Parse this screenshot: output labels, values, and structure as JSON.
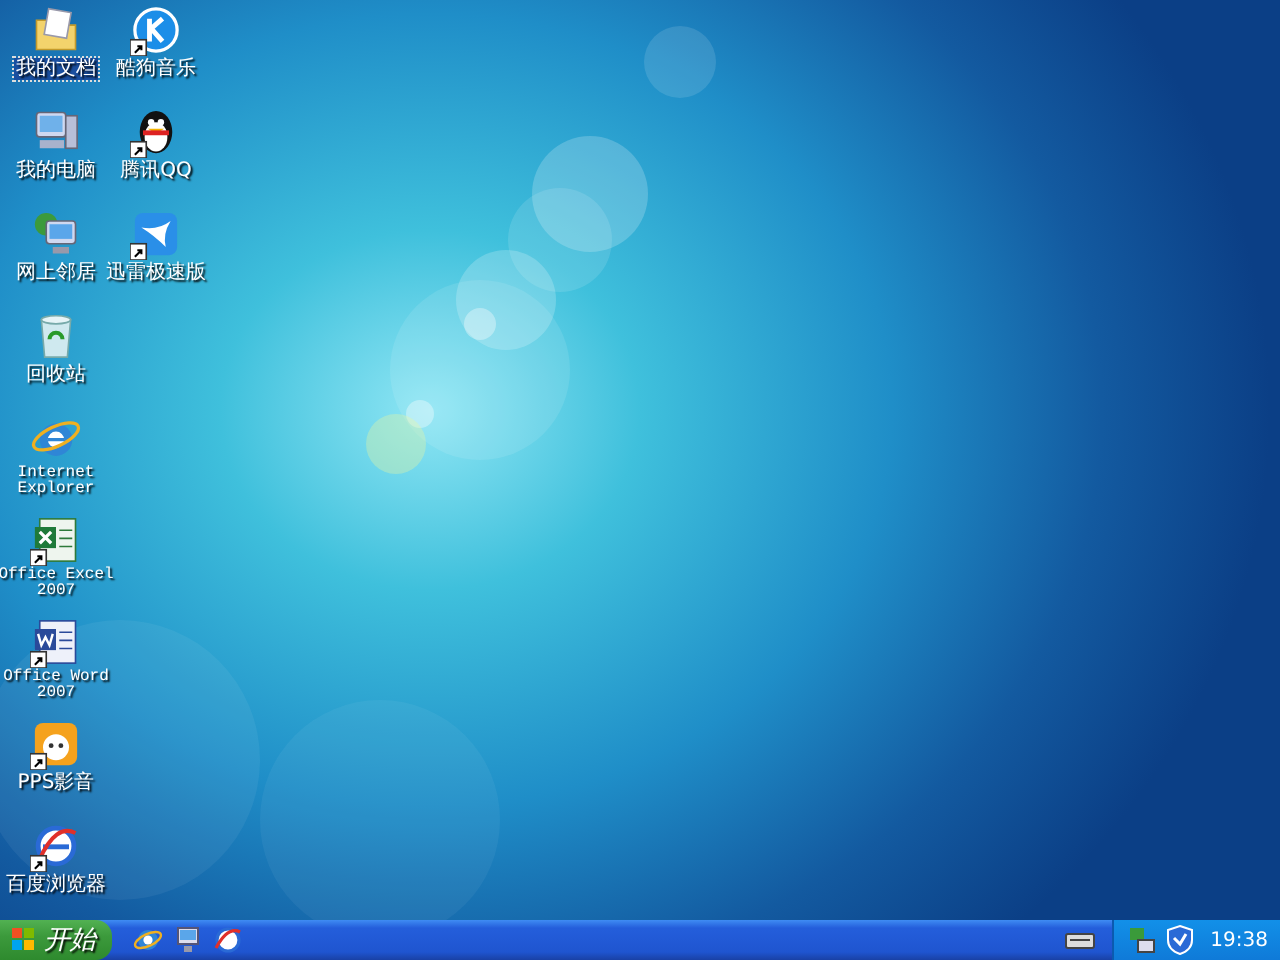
{
  "desktop": {
    "columns": [
      {
        "icons": [
          {
            "kind": "documents",
            "label": "我的文档",
            "shortcut": false,
            "selected": true
          },
          {
            "kind": "computer",
            "label": "我的电脑",
            "shortcut": false,
            "selected": false
          },
          {
            "kind": "network",
            "label": "网上邻居",
            "shortcut": false,
            "selected": false
          },
          {
            "kind": "recycle",
            "label": "回收站",
            "shortcut": false,
            "selected": false
          },
          {
            "kind": "ie",
            "label": "Internet Explorer",
            "shortcut": false,
            "selected": false
          },
          {
            "kind": "excel",
            "label": "Office Excel 2007",
            "shortcut": true,
            "selected": false
          },
          {
            "kind": "word",
            "label": "Office Word 2007",
            "shortcut": true,
            "selected": false
          },
          {
            "kind": "pps",
            "label": "PPS影音",
            "shortcut": true,
            "selected": false
          },
          {
            "kind": "browser",
            "label": "百度浏览器",
            "shortcut": true,
            "selected": false
          }
        ]
      },
      {
        "icons": [
          {
            "kind": "music",
            "label": "酷狗音乐",
            "shortcut": true,
            "selected": false
          },
          {
            "kind": "penguin",
            "label": "腾讯QQ",
            "shortcut": true,
            "selected": false
          },
          {
            "kind": "bird",
            "label": "迅雷极速版",
            "shortcut": true,
            "selected": false
          }
        ]
      }
    ]
  },
  "taskbar": {
    "start_label": "开始",
    "quick_launch": [
      {
        "kind": "ie"
      },
      {
        "kind": "desktop"
      },
      {
        "kind": "browser"
      }
    ],
    "tray": [
      {
        "kind": "keyboard"
      }
    ],
    "notification": [
      {
        "kind": "network"
      },
      {
        "kind": "shield"
      }
    ],
    "clock": "19:38"
  }
}
